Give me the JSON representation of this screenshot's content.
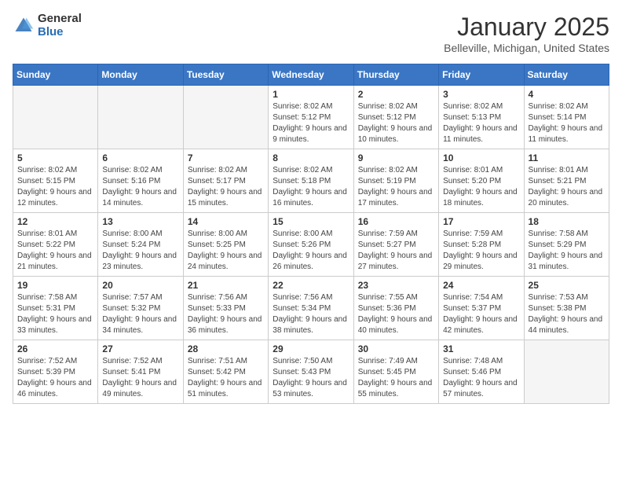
{
  "logo": {
    "general": "General",
    "blue": "Blue"
  },
  "header": {
    "month": "January 2025",
    "location": "Belleville, Michigan, United States"
  },
  "weekdays": [
    "Sunday",
    "Monday",
    "Tuesday",
    "Wednesday",
    "Thursday",
    "Friday",
    "Saturday"
  ],
  "weeks": [
    [
      {
        "day": "",
        "info": ""
      },
      {
        "day": "",
        "info": ""
      },
      {
        "day": "",
        "info": ""
      },
      {
        "day": "1",
        "info": "Sunrise: 8:02 AM\nSunset: 5:12 PM\nDaylight: 9 hours and 9 minutes."
      },
      {
        "day": "2",
        "info": "Sunrise: 8:02 AM\nSunset: 5:12 PM\nDaylight: 9 hours and 10 minutes."
      },
      {
        "day": "3",
        "info": "Sunrise: 8:02 AM\nSunset: 5:13 PM\nDaylight: 9 hours and 11 minutes."
      },
      {
        "day": "4",
        "info": "Sunrise: 8:02 AM\nSunset: 5:14 PM\nDaylight: 9 hours and 11 minutes."
      }
    ],
    [
      {
        "day": "5",
        "info": "Sunrise: 8:02 AM\nSunset: 5:15 PM\nDaylight: 9 hours and 12 minutes."
      },
      {
        "day": "6",
        "info": "Sunrise: 8:02 AM\nSunset: 5:16 PM\nDaylight: 9 hours and 14 minutes."
      },
      {
        "day": "7",
        "info": "Sunrise: 8:02 AM\nSunset: 5:17 PM\nDaylight: 9 hours and 15 minutes."
      },
      {
        "day": "8",
        "info": "Sunrise: 8:02 AM\nSunset: 5:18 PM\nDaylight: 9 hours and 16 minutes."
      },
      {
        "day": "9",
        "info": "Sunrise: 8:02 AM\nSunset: 5:19 PM\nDaylight: 9 hours and 17 minutes."
      },
      {
        "day": "10",
        "info": "Sunrise: 8:01 AM\nSunset: 5:20 PM\nDaylight: 9 hours and 18 minutes."
      },
      {
        "day": "11",
        "info": "Sunrise: 8:01 AM\nSunset: 5:21 PM\nDaylight: 9 hours and 20 minutes."
      }
    ],
    [
      {
        "day": "12",
        "info": "Sunrise: 8:01 AM\nSunset: 5:22 PM\nDaylight: 9 hours and 21 minutes."
      },
      {
        "day": "13",
        "info": "Sunrise: 8:00 AM\nSunset: 5:24 PM\nDaylight: 9 hours and 23 minutes."
      },
      {
        "day": "14",
        "info": "Sunrise: 8:00 AM\nSunset: 5:25 PM\nDaylight: 9 hours and 24 minutes."
      },
      {
        "day": "15",
        "info": "Sunrise: 8:00 AM\nSunset: 5:26 PM\nDaylight: 9 hours and 26 minutes."
      },
      {
        "day": "16",
        "info": "Sunrise: 7:59 AM\nSunset: 5:27 PM\nDaylight: 9 hours and 27 minutes."
      },
      {
        "day": "17",
        "info": "Sunrise: 7:59 AM\nSunset: 5:28 PM\nDaylight: 9 hours and 29 minutes."
      },
      {
        "day": "18",
        "info": "Sunrise: 7:58 AM\nSunset: 5:29 PM\nDaylight: 9 hours and 31 minutes."
      }
    ],
    [
      {
        "day": "19",
        "info": "Sunrise: 7:58 AM\nSunset: 5:31 PM\nDaylight: 9 hours and 33 minutes."
      },
      {
        "day": "20",
        "info": "Sunrise: 7:57 AM\nSunset: 5:32 PM\nDaylight: 9 hours and 34 minutes."
      },
      {
        "day": "21",
        "info": "Sunrise: 7:56 AM\nSunset: 5:33 PM\nDaylight: 9 hours and 36 minutes."
      },
      {
        "day": "22",
        "info": "Sunrise: 7:56 AM\nSunset: 5:34 PM\nDaylight: 9 hours and 38 minutes."
      },
      {
        "day": "23",
        "info": "Sunrise: 7:55 AM\nSunset: 5:36 PM\nDaylight: 9 hours and 40 minutes."
      },
      {
        "day": "24",
        "info": "Sunrise: 7:54 AM\nSunset: 5:37 PM\nDaylight: 9 hours and 42 minutes."
      },
      {
        "day": "25",
        "info": "Sunrise: 7:53 AM\nSunset: 5:38 PM\nDaylight: 9 hours and 44 minutes."
      }
    ],
    [
      {
        "day": "26",
        "info": "Sunrise: 7:52 AM\nSunset: 5:39 PM\nDaylight: 9 hours and 46 minutes."
      },
      {
        "day": "27",
        "info": "Sunrise: 7:52 AM\nSunset: 5:41 PM\nDaylight: 9 hours and 49 minutes."
      },
      {
        "day": "28",
        "info": "Sunrise: 7:51 AM\nSunset: 5:42 PM\nDaylight: 9 hours and 51 minutes."
      },
      {
        "day": "29",
        "info": "Sunrise: 7:50 AM\nSunset: 5:43 PM\nDaylight: 9 hours and 53 minutes."
      },
      {
        "day": "30",
        "info": "Sunrise: 7:49 AM\nSunset: 5:45 PM\nDaylight: 9 hours and 55 minutes."
      },
      {
        "day": "31",
        "info": "Sunrise: 7:48 AM\nSunset: 5:46 PM\nDaylight: 9 hours and 57 minutes."
      },
      {
        "day": "",
        "info": ""
      }
    ]
  ]
}
